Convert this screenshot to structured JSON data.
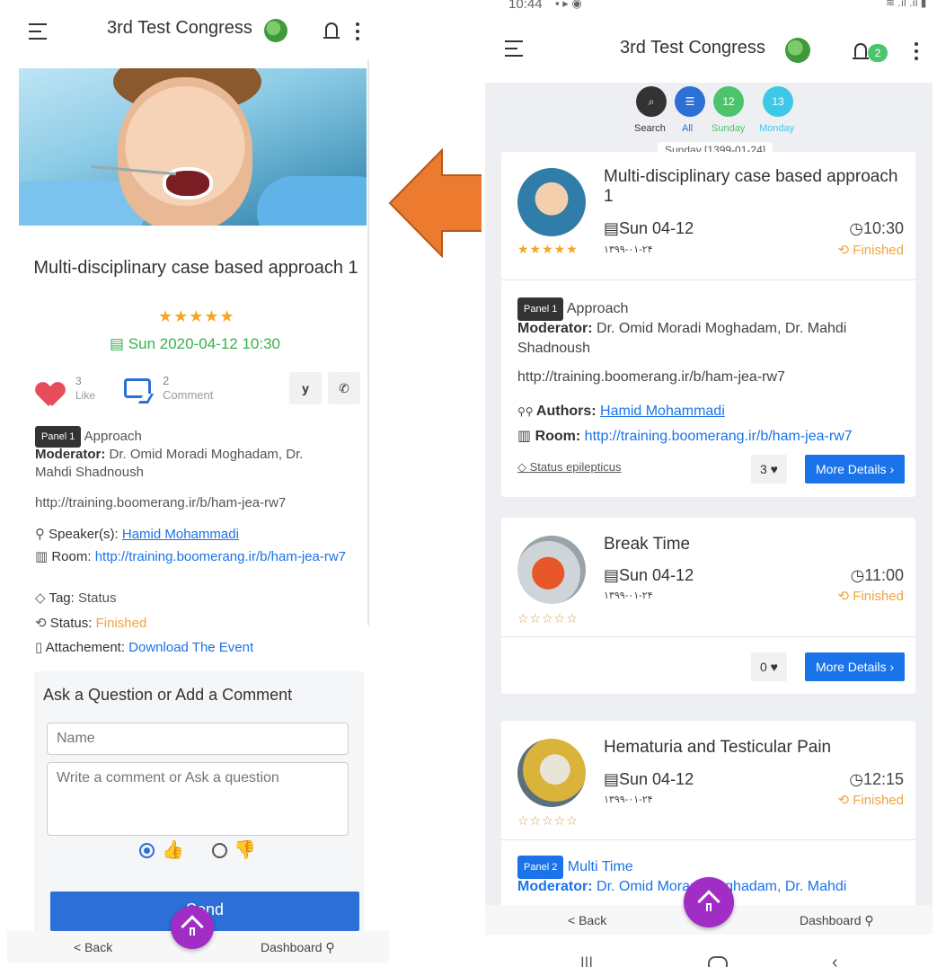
{
  "left": {
    "app_title": "3rd Test Congress",
    "event": {
      "title": "Multi-disciplinary case based approach 1",
      "stars": "★★★★★",
      "date_time": "Sun 2020-04-12 10:30",
      "like_count": "3",
      "like_label": "Like",
      "comment_count": "2",
      "comment_label": "Comment",
      "twitter_icon": "y",
      "whatsapp_icon": "✆",
      "panel_badge": "Panel 1",
      "panel_name": "Approach",
      "moderator_label": "Moderator:",
      "moderator_value": "Dr. Omid Moradi Moghadam, Dr. Mahdi Shadnoush",
      "link": "http://training.boomerang.ir/b/ham-jea-rw7",
      "speaker_label": "Speaker(s):",
      "speaker_value": "Hamid Mohammadi",
      "room_label": "Room:",
      "room_value": "http://training.boomerang.ir/b/ham-jea-rw7",
      "tag_label": "Tag:",
      "tag_value": "Status",
      "status_label": "Status:",
      "status_value": "Finished",
      "attach_label": "Attachement:",
      "attach_value": "Download The Event"
    },
    "qa": {
      "heading": "Ask a Question or Add a Comment",
      "name_placeholder": "Name",
      "comment_placeholder": "Write a comment or Ask a question",
      "send_label": "Send"
    },
    "bottom": {
      "back": "< Back",
      "dashboard": "Dashboard ⚲"
    }
  },
  "right": {
    "status_time": "10:44",
    "app_title": "3rd Test Congress",
    "notif_count": "2",
    "filters": [
      {
        "label": "Search",
        "icon": "⌕",
        "color": "#333333"
      },
      {
        "label": "All",
        "icon": "☰",
        "color": "#2c6fd6"
      },
      {
        "label": "Sunday",
        "icon": "12",
        "color": "#4cc46c"
      },
      {
        "label": "Monday",
        "icon": "13",
        "color": "#3ec8e8"
      }
    ],
    "date_chip": "Sunday [1399-01-24]",
    "cards": [
      {
        "title": "Multi-disciplinary case based approach 1",
        "date": "Sun 04-12",
        "fa_date": "۱۳۹۹-۰۱-۲۴",
        "time": "10:30",
        "status": "Finished",
        "stars": "★★★★★",
        "panel_badge": "Panel 1",
        "panel_name": "Approach",
        "moderator_label": "Moderator:",
        "moderator_value": "Dr. Omid Moradi Moghadam, Dr. Mahdi Shadnoush",
        "link": "http://training.boomerang.ir/b/ham-jea-rw7",
        "authors_label": "Authors:",
        "authors_value": "Hamid Mohammadi",
        "room_label": "Room:",
        "room_value": "http://training.boomerang.ir/b/ham-jea-rw7",
        "tag": "Status epilepticus",
        "likes": "3 ♥",
        "more": "More Details ›"
      },
      {
        "title": "Break Time",
        "date": "Sun 04-12",
        "fa_date": "۱۳۹۹-۰۱-۲۴",
        "time": "11:00",
        "status": "Finished",
        "stars": "☆☆☆☆☆",
        "likes": "0 ♥",
        "more": "More Details ›"
      },
      {
        "title": "Hematuria and Testicular Pain",
        "date": "Sun 04-12",
        "fa_date": "۱۳۹۹-۰۱-۲۴",
        "time": "12:15",
        "status": "Finished",
        "stars": "☆☆☆☆☆",
        "panel_badge": "Panel 2",
        "panel_name": "Multi Time",
        "moderator_label": "Moderator:",
        "moderator_value": "Dr. Omid Moradi Moghadam, Dr. Mahdi"
      }
    ],
    "bottom": {
      "back": "< Back",
      "dashboard": "Dashboard ⚲"
    }
  }
}
